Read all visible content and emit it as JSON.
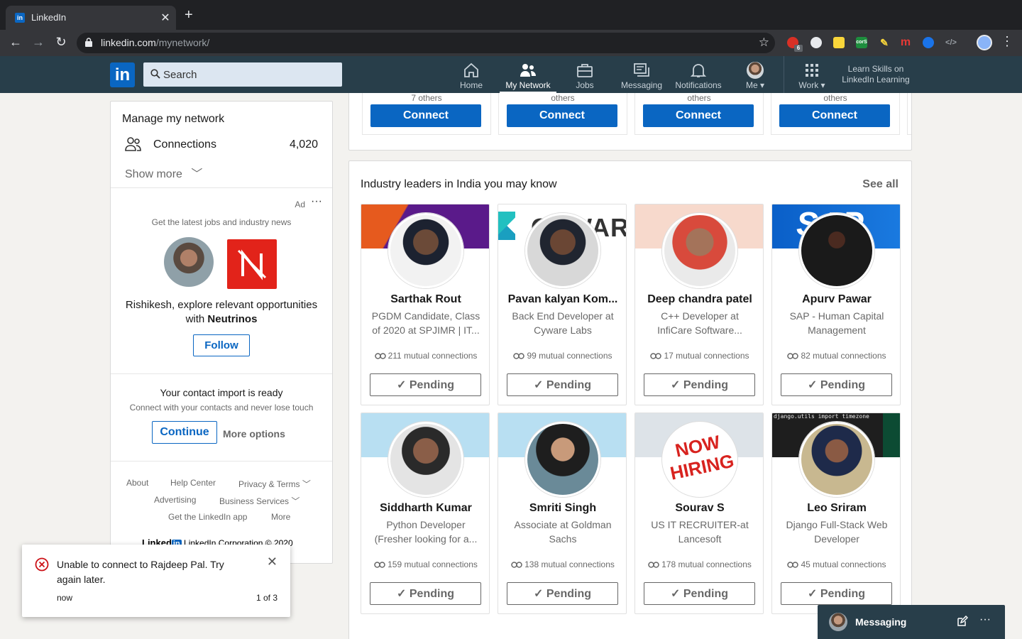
{
  "browser": {
    "tab_title": "LinkedIn",
    "tab_favicon": "in",
    "url_host": "linkedin.com",
    "url_path": "/mynetwork/",
    "extension_badge": "6",
    "ext_labels": [
      "corS"
    ]
  },
  "nav": {
    "logo": "in",
    "search_placeholder": "Search",
    "items": [
      {
        "label": "Home",
        "icon": "home-icon"
      },
      {
        "label": "My Network",
        "icon": "network-icon"
      },
      {
        "label": "Jobs",
        "icon": "briefcase-icon"
      },
      {
        "label": "Messaging",
        "icon": "messaging-icon"
      },
      {
        "label": "Notifications",
        "icon": "bell-icon"
      },
      {
        "label": "Me",
        "icon": "avatar"
      },
      {
        "label": "Work",
        "icon": "grid-icon"
      }
    ],
    "learning": "Learn Skills on LinkedIn Learning"
  },
  "sidebar": {
    "title": "Manage my network",
    "connections_label": "Connections",
    "connections_count": "4,020",
    "show_more": "Show more",
    "ad": {
      "label": "Ad",
      "text": "Get the latest jobs and industry news",
      "message_pre": "Rishikesh, explore relevant opportunities with ",
      "message_brand": "Neutrinos",
      "follow": "Follow"
    },
    "import": {
      "title": "Your contact import is ready",
      "subtitle": "Connect with your contacts and never lose touch",
      "continue": "Continue",
      "more_options": "More options"
    },
    "footer": {
      "about": "About",
      "help": "Help Center",
      "privacy": "Privacy & Terms",
      "advertising": "Advertising",
      "business": "Business Services",
      "app": "Get the LinkedIn app",
      "more": "More",
      "brand": "Linked",
      "brand_in": "in",
      "copyright": "LinkedIn Corporation © 2020"
    }
  },
  "top_row": {
    "cards": [
      {
        "others": "7 others",
        "button": "Connect"
      },
      {
        "others": "others",
        "button": "Connect"
      },
      {
        "others": "others",
        "button": "Connect"
      },
      {
        "others": "others",
        "button": "Connect"
      }
    ]
  },
  "industry": {
    "title": "Industry leaders in India you may know",
    "see_all": "See all",
    "people": [
      {
        "name": "Sarthak Rout",
        "headline": "PGDM Candidate, Class of 2020 at SPJIMR | IT...",
        "mutual": "211 mutual connections",
        "button": "Pending"
      },
      {
        "name": "Pavan kalyan Kom...",
        "headline": "Back End Developer at Cyware Labs",
        "mutual": "99 mutual connections",
        "button": "Pending",
        "banner_text": "CYWAR"
      },
      {
        "name": "Deep chandra patel",
        "headline": "C++ Developer at InfiCare Software...",
        "mutual": "17 mutual connections",
        "button": "Pending"
      },
      {
        "name": "Apurv Pawar",
        "headline": "SAP - Human Capital Management",
        "mutual": "82 mutual connections",
        "button": "Pending",
        "banner_text": "SAP"
      },
      {
        "name": "Siddharth Kumar",
        "headline": "Python Developer (Fresher looking for a...",
        "mutual": "159 mutual connections",
        "button": "Pending"
      },
      {
        "name": "Smriti Singh",
        "headline": "Associate at Goldman Sachs",
        "mutual": "138 mutual connections",
        "button": "Pending"
      },
      {
        "name": "Sourav S",
        "headline": "US IT RECRUITER-at Lancesoft",
        "mutual": "178 mutual connections",
        "button": "Pending",
        "avatar_text": "NOW HIRING"
      },
      {
        "name": "Leo Sriram",
        "headline": "Django Full-Stack Web Developer",
        "mutual": "45 mutual connections",
        "button": "Pending",
        "banner_text": "django.utils import timezone"
      }
    ]
  },
  "toast": {
    "message": "Unable to connect to Rajdeep Pal. Try again later.",
    "time": "now",
    "count": "1 of 3"
  },
  "messaging": {
    "label": "Messaging"
  },
  "colors": {
    "brand": "#0a66c2",
    "nav_bg": "#283e4a",
    "error": "#cc1016"
  }
}
